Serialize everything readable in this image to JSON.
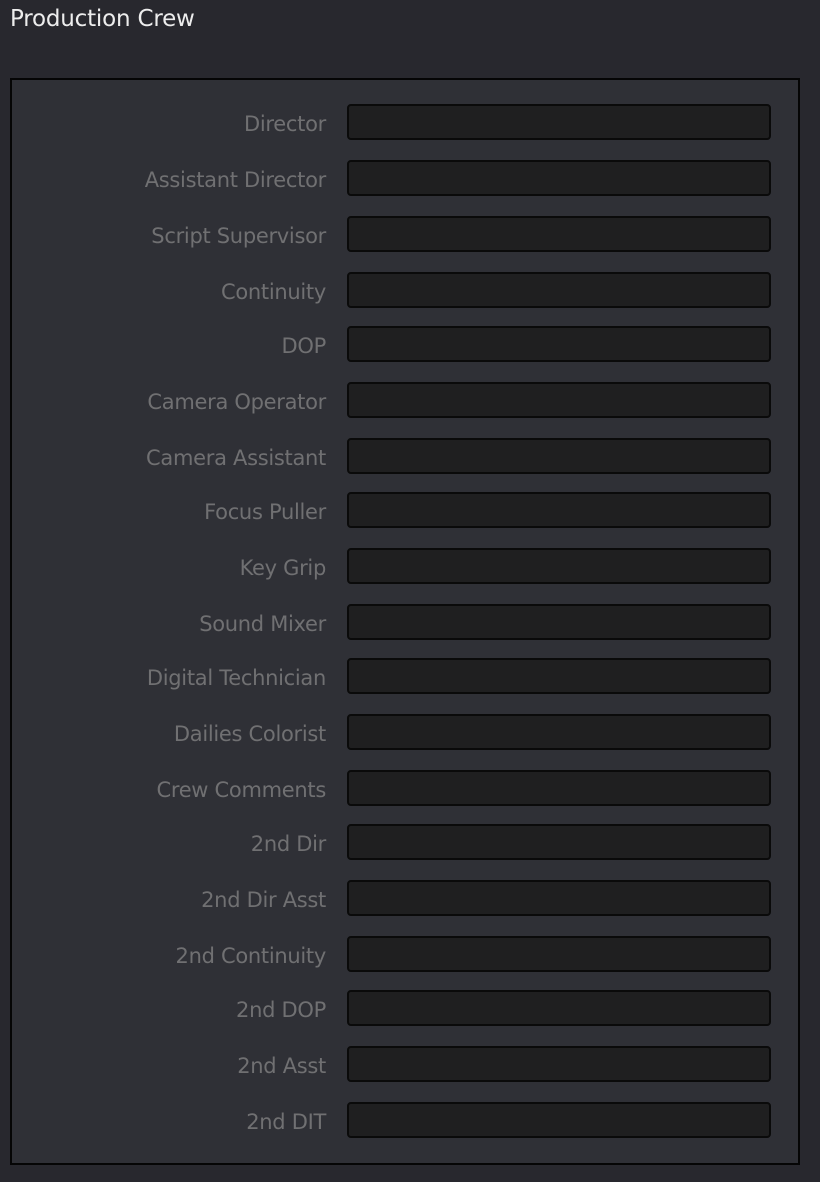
{
  "title": "Production Crew",
  "fields": [
    {
      "label": "Director",
      "value": ""
    },
    {
      "label": "Assistant Director",
      "value": ""
    },
    {
      "label": "Script Supervisor",
      "value": ""
    },
    {
      "label": "Continuity",
      "value": ""
    },
    {
      "label": "DOP",
      "value": ""
    },
    {
      "label": "Camera Operator",
      "value": ""
    },
    {
      "label": "Camera Assistant",
      "value": ""
    },
    {
      "label": "Focus Puller",
      "value": ""
    },
    {
      "label": "Key Grip",
      "value": ""
    },
    {
      "label": "Sound Mixer",
      "value": ""
    },
    {
      "label": "Digital Technician",
      "value": ""
    },
    {
      "label": "Dailies Colorist",
      "value": ""
    },
    {
      "label": "Crew Comments",
      "value": ""
    },
    {
      "label": "2nd Dir",
      "value": ""
    },
    {
      "label": "2nd Dir Asst",
      "value": ""
    },
    {
      "label": "2nd Continuity",
      "value": ""
    },
    {
      "label": "2nd DOP",
      "value": ""
    },
    {
      "label": "2nd Asst",
      "value": ""
    },
    {
      "label": "2nd DIT",
      "value": ""
    }
  ]
}
